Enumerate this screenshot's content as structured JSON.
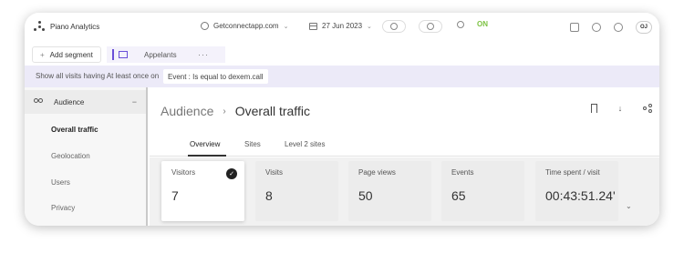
{
  "brand": {
    "name": "Piano Analytics"
  },
  "topbar": {
    "site": "Getconnectapp.com",
    "date": "27 Jun 2023",
    "status": "ON",
    "avatar": "OJ"
  },
  "segments": {
    "add_label": "Add segment",
    "items": [
      {
        "label": "Appelants"
      }
    ],
    "more": "···"
  },
  "filter": {
    "text": "Show all visits having At least once on",
    "chip": "Event : Is equal to dexem.call"
  },
  "sidebar": {
    "group": "Audience",
    "collapse": "−",
    "items": [
      {
        "label": "Overall traffic",
        "active": true
      },
      {
        "label": "Geolocation"
      },
      {
        "label": "Users"
      },
      {
        "label": "Privacy"
      }
    ]
  },
  "main": {
    "breadcrumb": {
      "parent": "Audience",
      "separator": "›",
      "current": "Overall traffic"
    },
    "actions": {
      "download": "↓"
    },
    "tabs": [
      {
        "label": "Overview"
      },
      {
        "label": "Sites"
      },
      {
        "label": "Level 2 sites"
      }
    ],
    "cards": [
      {
        "label": "Visitors",
        "value": "7"
      },
      {
        "label": "Visits",
        "value": "8"
      },
      {
        "label": "Page views",
        "value": "50"
      },
      {
        "label": "Events",
        "value": "65"
      },
      {
        "label": "Time spent / visit",
        "value": "00:43:51.24'"
      }
    ],
    "expand": "⌄"
  },
  "icons": {
    "check": "✓",
    "chevron": "⌄",
    "plus": "+"
  },
  "colors": {
    "accent": "#6a4fd8",
    "filter_bg": "#eceaf8",
    "status_on": "#7cc242"
  }
}
